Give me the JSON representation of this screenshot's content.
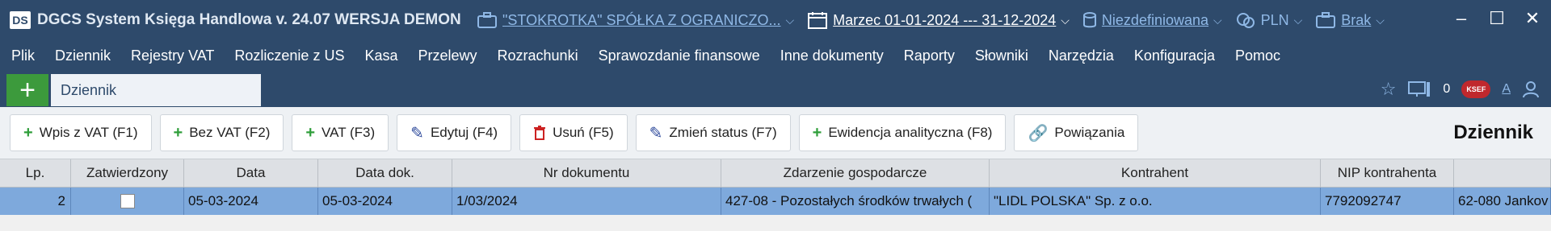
{
  "titlebar": {
    "logo": "DS",
    "app_title": "DGCS System Księga Handlowa v. 24.07  WERSJA DEMON",
    "company": "\"STOKROTKA\" SPÓŁKA Z OGRANICZO...",
    "period": "Marzec 01-01-2024 --- 31-12-2024",
    "department": "Niezdefiniowana",
    "currency": "PLN",
    "warehouse": "Brak"
  },
  "menu": [
    "Plik",
    "Dziennik",
    "Rejestry VAT",
    "Rozliczenie z US",
    "Kasa",
    "Przelewy",
    "Rozrachunki",
    "Sprawozdanie finansowe",
    "Inne dokumenty",
    "Raporty",
    "Słowniki",
    "Narzędzia",
    "Konfiguracja",
    "Pomoc"
  ],
  "tabs": {
    "active": "Dziennik",
    "notification_count": "0",
    "ksef_badge": "KSEF",
    "font_label": "A"
  },
  "toolbar": {
    "buttons": [
      {
        "label": "Wpis z VAT (F1)",
        "icon": "plus-icon"
      },
      {
        "label": "Bez VAT (F2)",
        "icon": "plus-icon"
      },
      {
        "label": "VAT (F3)",
        "icon": "plus-icon"
      },
      {
        "label": "Edytuj (F4)",
        "icon": "edit-icon"
      },
      {
        "label": "Usuń (F5)",
        "icon": "trash-icon"
      },
      {
        "label": "Zmień status (F7)",
        "icon": "edit-icon"
      },
      {
        "label": "Ewidencja analityczna (F8)",
        "icon": "plus-icon"
      },
      {
        "label": "Powiązania",
        "icon": "link-icon"
      }
    ],
    "page_title": "Dziennik"
  },
  "grid": {
    "columns": [
      "Lp.",
      "Zatwierdzony",
      "Data",
      "Data dok.",
      "Nr dokumentu",
      "Zdarzenie gospodarcze",
      "Kontrahent",
      "NIP kontrahenta",
      ""
    ],
    "rows": [
      [
        "2",
        "",
        "05-03-2024",
        "05-03-2024",
        "1/03/2024",
        "427-08 - Pozostałych środków trwałych (",
        "\"LIDL POLSKA\" Sp. z o.o.",
        "7792092747",
        "62-080 Jankov"
      ]
    ]
  },
  "colors": {
    "title_bg": "#2e4a6b",
    "accent_link": "#8fb8e6",
    "add_green": "#3c9a3c",
    "selected_row": "#7ea9dc",
    "ksef_red": "#c0282d"
  }
}
